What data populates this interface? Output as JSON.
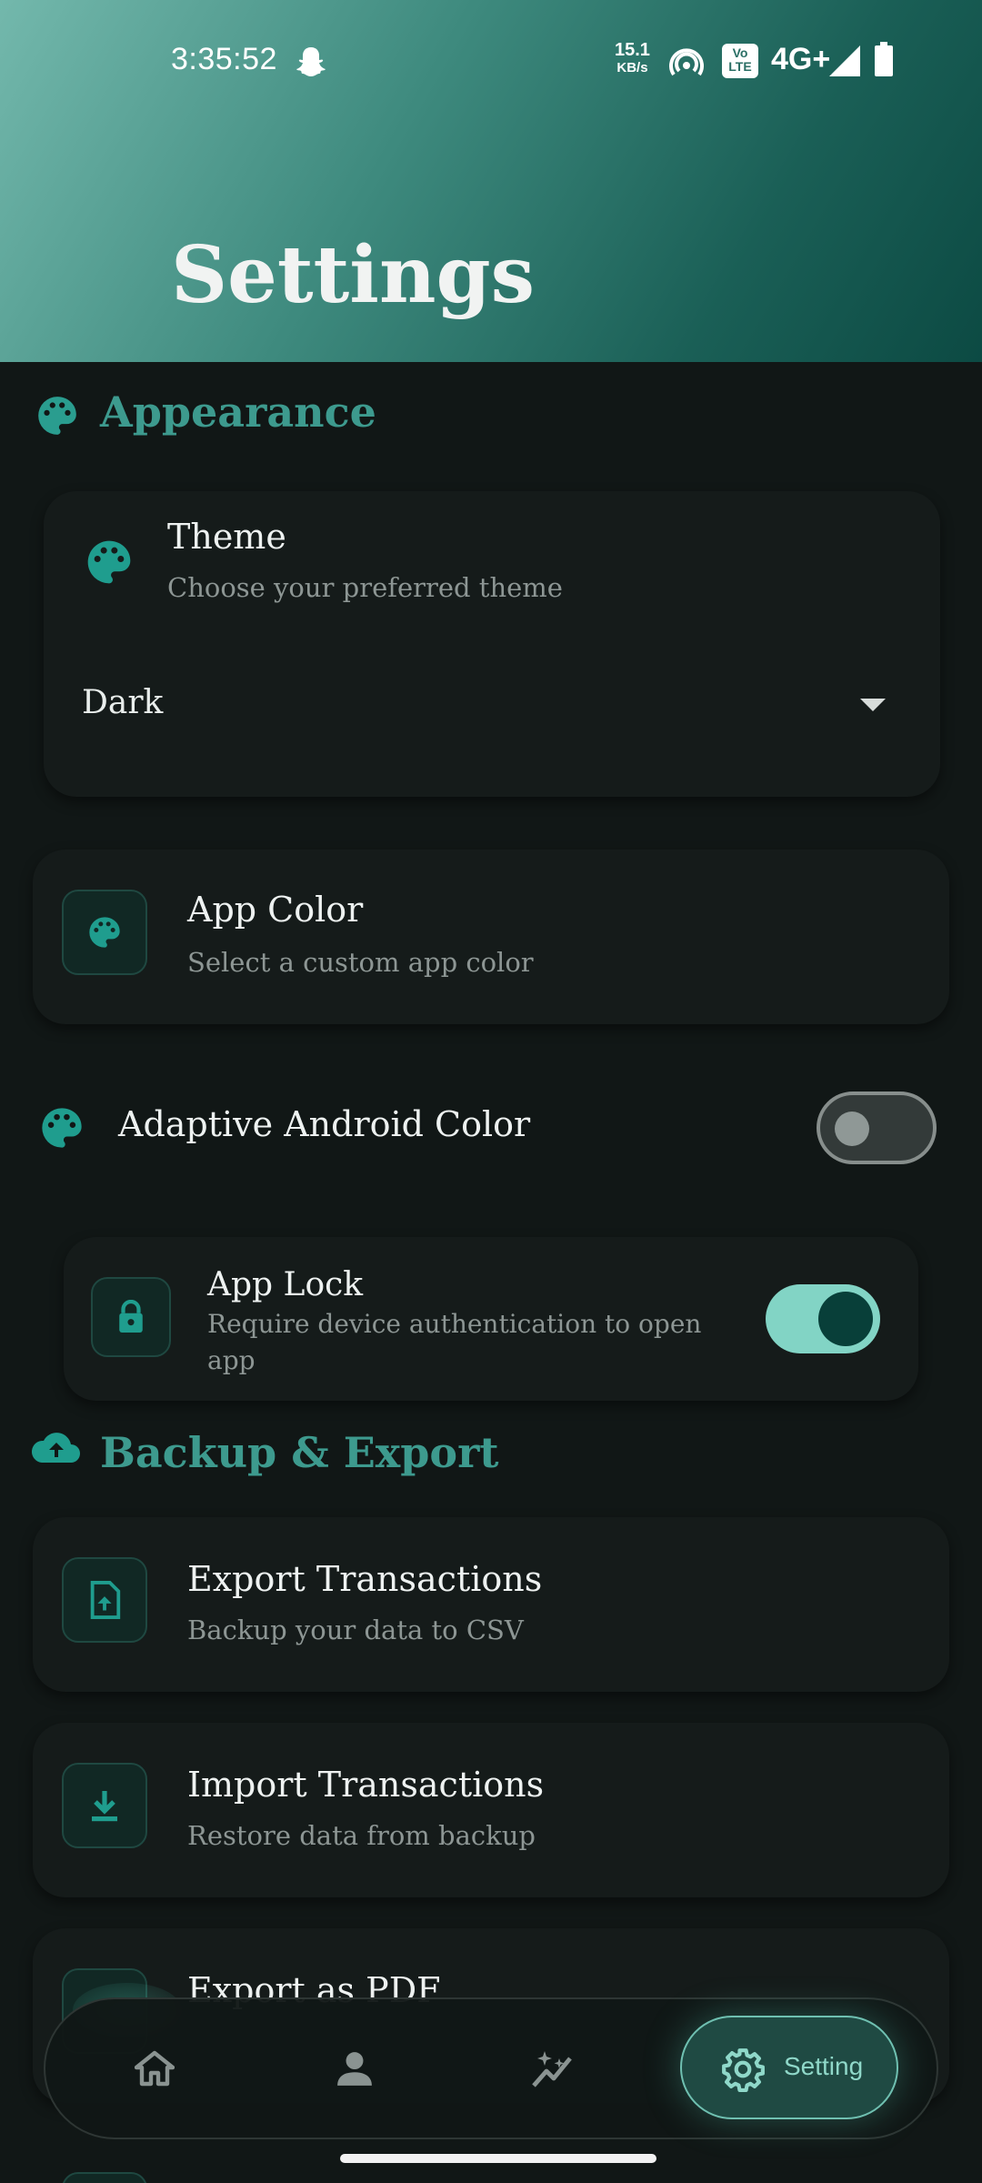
{
  "status_bar": {
    "time": "3:35:52",
    "net_speed_value": "15.1",
    "net_speed_unit": "KB/s",
    "volte": "Vo LTE",
    "network": "4G+"
  },
  "header": {
    "title": "Settings"
  },
  "appearance": {
    "section_title": "Appearance",
    "theme": {
      "title": "Theme",
      "subtitle": "Choose your preferred theme",
      "selected": "Dark"
    },
    "app_color": {
      "title": "App Color",
      "subtitle": "Select a custom app color"
    },
    "adaptive": {
      "title": "Adaptive Android Color",
      "enabled": false
    },
    "app_lock": {
      "title": "App Lock",
      "subtitle_line1": "Require device authentication to open",
      "subtitle_line2": "app",
      "enabled": true
    }
  },
  "backup": {
    "section_title": "Backup & Export",
    "export": {
      "title": "Export Transactions",
      "subtitle": "Backup your data to CSV"
    },
    "import": {
      "title": "Import Transactions",
      "subtitle": "Restore data from backup"
    },
    "pdf": {
      "title": "Export as PDF"
    }
  },
  "bottom_nav": {
    "items": [
      {
        "icon": "home-icon"
      },
      {
        "icon": "person-icon"
      },
      {
        "icon": "insights-icon"
      },
      {
        "icon": "gear-icon",
        "label": "Setting",
        "active": true
      }
    ]
  },
  "colors": {
    "accent": "#3d9a8e",
    "background": "#111716",
    "card": "#151b1a",
    "toggle_on": "#82d4c5"
  }
}
